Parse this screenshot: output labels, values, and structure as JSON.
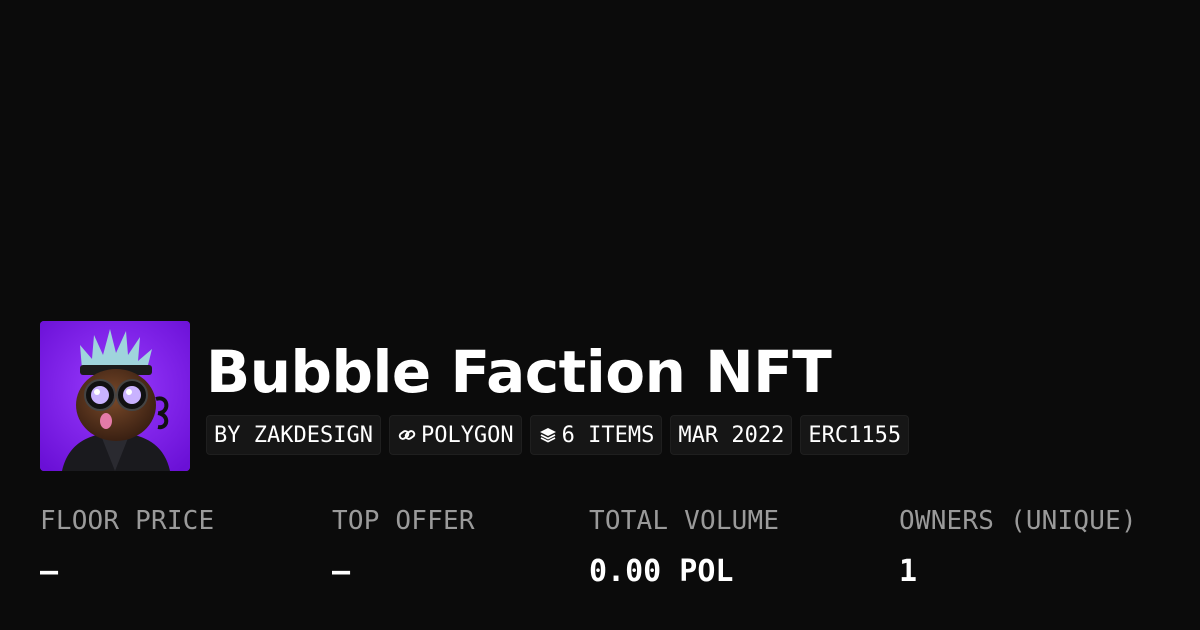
{
  "collection": {
    "title": "Bubble Faction NFT",
    "avatar_alt": "collection-avatar",
    "accent_color": "#7b17e0"
  },
  "pills": {
    "creator": "BY ZAKDESIGN",
    "chain": "POLYGON",
    "chain_icon": "link-icon",
    "items": "6 ITEMS",
    "items_icon": "layers-icon",
    "date": "MAR 2022",
    "standard": "ERC1155"
  },
  "stats": {
    "floor_price": {
      "label": "FLOOR PRICE",
      "value": "–"
    },
    "top_offer": {
      "label": "TOP OFFER",
      "value": "–"
    },
    "total_volume": {
      "label": "TOTAL VOLUME",
      "value": "0.00 POL"
    },
    "owners": {
      "label": "OWNERS (UNIQUE)",
      "value": "1"
    }
  }
}
